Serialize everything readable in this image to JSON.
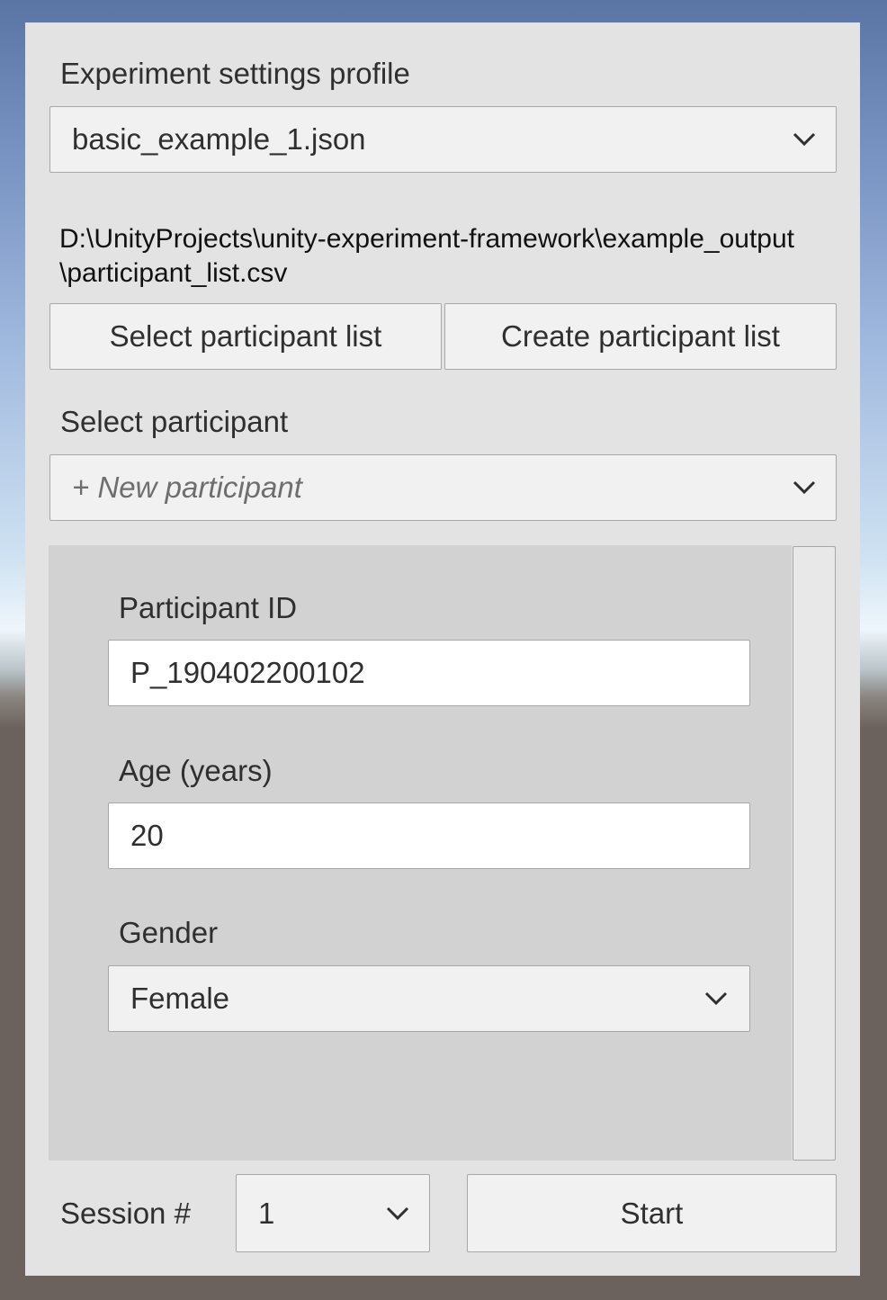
{
  "settings_profile": {
    "label": "Experiment settings profile",
    "selected": "basic_example_1.json"
  },
  "participant_list": {
    "path": "D:\\UnityProjects\\unity-experiment-framework\\example_output\\participant_list.csv",
    "select_button": "Select participant list",
    "create_button": "Create participant list"
  },
  "participant_select": {
    "label": "Select participant",
    "placeholder": "+ New participant"
  },
  "form": {
    "participant_id": {
      "label": "Participant ID",
      "value": "P_190402200102"
    },
    "age": {
      "label": "Age (years)",
      "value": "20"
    },
    "gender": {
      "label": "Gender",
      "selected": "Female"
    }
  },
  "footer": {
    "session_label": "Session #",
    "session_value": "1",
    "start_button": "Start"
  },
  "icons": {
    "dropdown": "chevron-down-icon"
  },
  "colors": {
    "panel_background": "#e3e3e3",
    "scroll_area_background": "#d2d2d2",
    "control_background": "#f1f1f1",
    "control_border": "#a7a7a7",
    "input_background": "#ffffff"
  }
}
